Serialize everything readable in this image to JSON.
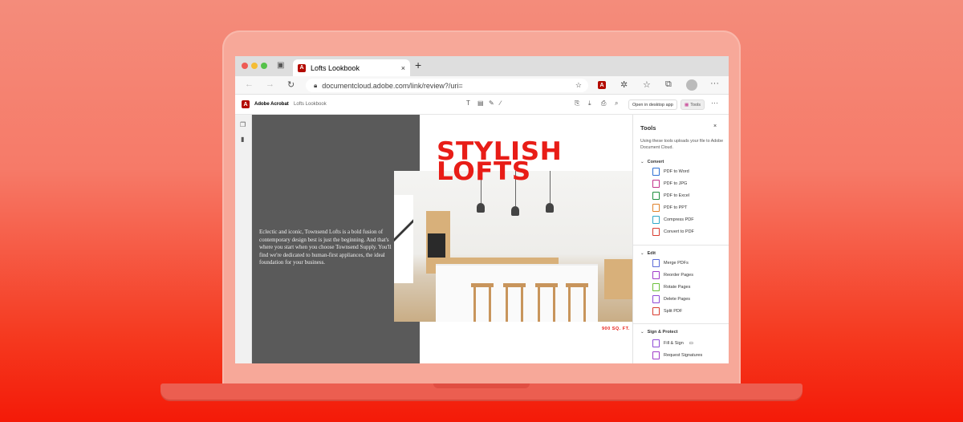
{
  "browser": {
    "tab_title": "Lofts Lookbook",
    "close_tab": "×",
    "new_tab": "+",
    "url": "documentcloud.adobe.com/link/review?/uri=",
    "more": "···"
  },
  "acrobat": {
    "app_name": "Adobe Acrobat",
    "doc_name": "Lofts Lookbook",
    "open_desktop": "Open in desktop app",
    "tools_button": "Tools",
    "more": "···"
  },
  "document": {
    "title_line1": "STYLISH",
    "title_line2": "LOFTS",
    "blurb": "Eclectic and iconic, Townsend Lofts is a bold fusion of contemporary design best is just the beginning. And that's where you start when you choose Townsend Supply. You'll find we're dedicated to human-first appliances, the ideal foundation for your business.",
    "area": "900 SQ. FT."
  },
  "tools_panel": {
    "title": "Tools",
    "close": "×",
    "description": "Using these tools uploads your file to Adobe Document Cloud.",
    "sections": [
      {
        "label": "Convert",
        "items": [
          {
            "label": "PDF to Word",
            "color": "#2d6fd3"
          },
          {
            "label": "PDF to JPG",
            "color": "#c2308a"
          },
          {
            "label": "PDF to Excel",
            "color": "#1e8e3e"
          },
          {
            "label": "PDF to PPT",
            "color": "#e0822b"
          },
          {
            "label": "Compress PDF",
            "color": "#2fa8c9"
          },
          {
            "label": "Convert to PDF",
            "color": "#d83b2f"
          }
        ]
      },
      {
        "label": "Edit",
        "items": [
          {
            "label": "Merge PDFs",
            "color": "#5a6ad8"
          },
          {
            "label": "Reorder Pages",
            "color": "#a03cc8"
          },
          {
            "label": "Rotate Pages",
            "color": "#6bbf3a"
          },
          {
            "label": "Delete Pages",
            "color": "#8f4bd6"
          },
          {
            "label": "Split PDF",
            "color": "#d83b2f"
          }
        ]
      },
      {
        "label": "Sign & Protect",
        "items": [
          {
            "label": "Fill & Sign",
            "color": "#8f4bd6"
          },
          {
            "label": "Request Signatures",
            "color": "#a03cc8"
          }
        ]
      }
    ]
  },
  "colors": {
    "accent": "#e81d17",
    "acrobat_red": "#b30b00"
  }
}
